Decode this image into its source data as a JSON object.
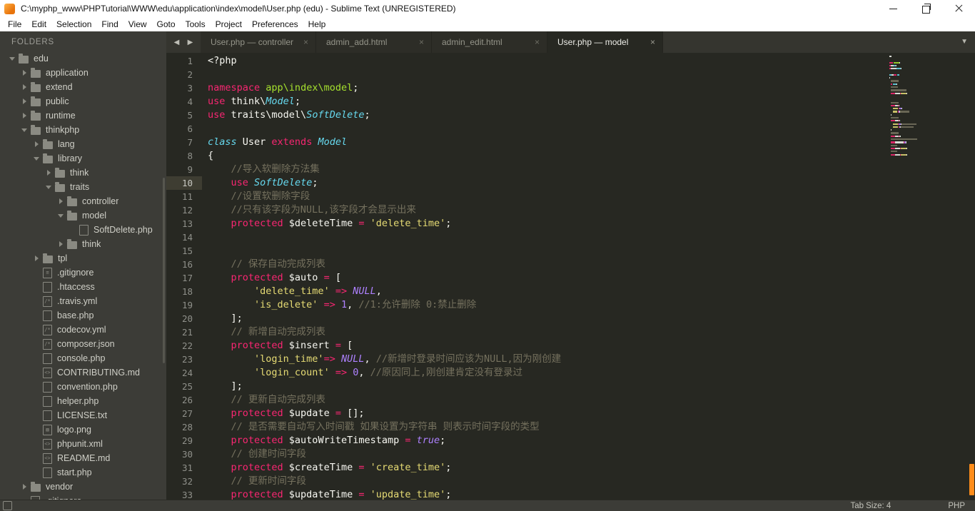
{
  "window": {
    "title": "C:\\myphp_www\\PHPTutorial\\WWW\\edu\\application\\index\\model\\User.php (edu) - Sublime Text (UNREGISTERED)"
  },
  "menu": [
    "File",
    "Edit",
    "Selection",
    "Find",
    "View",
    "Goto",
    "Tools",
    "Project",
    "Preferences",
    "Help"
  ],
  "icons": {
    "nav_back": "◀",
    "nav_forward": "▶",
    "overflow": "▼",
    "tab_close": "×"
  },
  "sidebar": {
    "header": "FOLDERS",
    "items": [
      {
        "label": "edu",
        "icon": "folder",
        "arrow": "open",
        "depth": 0
      },
      {
        "label": "application",
        "icon": "folder",
        "arrow": "closed",
        "depth": 1
      },
      {
        "label": "extend",
        "icon": "folder",
        "arrow": "closed",
        "depth": 1
      },
      {
        "label": "public",
        "icon": "folder",
        "arrow": "closed",
        "depth": 1
      },
      {
        "label": "runtime",
        "icon": "folder",
        "arrow": "closed",
        "depth": 1
      },
      {
        "label": "thinkphp",
        "icon": "folder",
        "arrow": "open",
        "depth": 1
      },
      {
        "label": "lang",
        "icon": "folder",
        "arrow": "closed",
        "depth": 2
      },
      {
        "label": "library",
        "icon": "folder",
        "arrow": "open",
        "depth": 2
      },
      {
        "label": "think",
        "icon": "folder",
        "arrow": "closed",
        "depth": 3
      },
      {
        "label": "traits",
        "icon": "folder",
        "arrow": "open",
        "depth": 3
      },
      {
        "label": "controller",
        "icon": "folder",
        "arrow": "closed",
        "depth": 4
      },
      {
        "label": "model",
        "icon": "folder",
        "arrow": "open",
        "depth": 4
      },
      {
        "label": "SoftDelete.php",
        "icon": "file",
        "arrow": "none",
        "depth": 5
      },
      {
        "label": "think",
        "icon": "folder",
        "arrow": "closed",
        "depth": 4
      },
      {
        "label": "tpl",
        "icon": "folder",
        "arrow": "closed",
        "depth": 2
      },
      {
        "label": ".gitignore",
        "icon": "file-list",
        "arrow": "none",
        "depth": 2
      },
      {
        "label": ".htaccess",
        "icon": "file",
        "arrow": "none",
        "depth": 2
      },
      {
        "label": ".travis.yml",
        "icon": "file-config",
        "arrow": "none",
        "depth": 2
      },
      {
        "label": "base.php",
        "icon": "file",
        "arrow": "none",
        "depth": 2
      },
      {
        "label": "codecov.yml",
        "icon": "file-config",
        "arrow": "none",
        "depth": 2
      },
      {
        "label": "composer.json",
        "icon": "file-config",
        "arrow": "none",
        "depth": 2
      },
      {
        "label": "console.php",
        "icon": "file",
        "arrow": "none",
        "depth": 2
      },
      {
        "label": "CONTRIBUTING.md",
        "icon": "file-code",
        "arrow": "none",
        "depth": 2
      },
      {
        "label": "convention.php",
        "icon": "file",
        "arrow": "none",
        "depth": 2
      },
      {
        "label": "helper.php",
        "icon": "file",
        "arrow": "none",
        "depth": 2
      },
      {
        "label": "LICENSE.txt",
        "icon": "file",
        "arrow": "none",
        "depth": 2
      },
      {
        "label": "logo.png",
        "icon": "file-image",
        "arrow": "none",
        "depth": 2
      },
      {
        "label": "phpunit.xml",
        "icon": "file-code",
        "arrow": "none",
        "depth": 2
      },
      {
        "label": "README.md",
        "icon": "file-code",
        "arrow": "none",
        "depth": 2
      },
      {
        "label": "start.php",
        "icon": "file",
        "arrow": "none",
        "depth": 2
      },
      {
        "label": "vendor",
        "icon": "folder",
        "arrow": "closed",
        "depth": 1
      },
      {
        "label": ".gitignore",
        "icon": "file-list",
        "arrow": "none",
        "depth": 1
      }
    ]
  },
  "tabs": [
    {
      "label": "User.php — controller",
      "active": false
    },
    {
      "label": "admin_add.html",
      "active": false
    },
    {
      "label": "admin_edit.html",
      "active": false
    },
    {
      "label": "User.php — model",
      "active": true
    }
  ],
  "editor": {
    "active_line": 10,
    "lines": [
      {
        "n": 1,
        "t": [
          [
            "pl",
            "<?php"
          ]
        ]
      },
      {
        "n": 2,
        "t": []
      },
      {
        "n": 3,
        "t": [
          [
            "kw",
            "namespace"
          ],
          [
            "pl",
            " "
          ],
          [
            "gr",
            "app\\index\\model"
          ],
          [
            "pl",
            ";"
          ]
        ]
      },
      {
        "n": 4,
        "t": [
          [
            "kw",
            "use"
          ],
          [
            "pl",
            " think\\"
          ],
          [
            "ty",
            "Model"
          ],
          [
            "pl",
            ";"
          ]
        ]
      },
      {
        "n": 5,
        "t": [
          [
            "kw",
            "use"
          ],
          [
            "pl",
            " traits\\model\\"
          ],
          [
            "ty",
            "SoftDelete"
          ],
          [
            "pl",
            ";"
          ]
        ]
      },
      {
        "n": 6,
        "t": []
      },
      {
        "n": 7,
        "t": [
          [
            "ty",
            "class"
          ],
          [
            "pl",
            " User "
          ],
          [
            "kw",
            "extends"
          ],
          [
            "pl",
            " "
          ],
          [
            "ty",
            "Model"
          ]
        ]
      },
      {
        "n": 8,
        "t": [
          [
            "pl",
            "{"
          ]
        ]
      },
      {
        "n": 9,
        "t": [
          [
            "cm",
            "    //导入软删除方法集"
          ]
        ]
      },
      {
        "n": 10,
        "t": [
          [
            "pl",
            "    "
          ],
          [
            "kw",
            "use"
          ],
          [
            "pl",
            " "
          ],
          [
            "ty",
            "SoftDelete"
          ],
          [
            "pl",
            ";"
          ]
        ]
      },
      {
        "n": 11,
        "t": [
          [
            "cm",
            "    //设置软删除字段"
          ]
        ]
      },
      {
        "n": 12,
        "t": [
          [
            "cm",
            "    //只有该字段为NULL,该字段才会显示出来"
          ]
        ]
      },
      {
        "n": 13,
        "t": [
          [
            "pl",
            "    "
          ],
          [
            "kw",
            "protected"
          ],
          [
            "pl",
            " $deleteTime "
          ],
          [
            "kw",
            "="
          ],
          [
            "pl",
            " "
          ],
          [
            "str",
            "'delete_time'"
          ],
          [
            "pl",
            ";"
          ]
        ]
      },
      {
        "n": 14,
        "t": []
      },
      {
        "n": 15,
        "t": []
      },
      {
        "n": 16,
        "t": [
          [
            "cm",
            "    // 保存自动完成列表"
          ]
        ]
      },
      {
        "n": 17,
        "t": [
          [
            "pl",
            "    "
          ],
          [
            "kw",
            "protected"
          ],
          [
            "pl",
            " $auto "
          ],
          [
            "kw",
            "="
          ],
          [
            "pl",
            " ["
          ]
        ]
      },
      {
        "n": 18,
        "t": [
          [
            "pl",
            "        "
          ],
          [
            "str",
            "'delete_time'"
          ],
          [
            "pl",
            " "
          ],
          [
            "kw",
            "=>"
          ],
          [
            "pl",
            " "
          ],
          [
            "cni",
            "NULL"
          ],
          [
            "pl",
            ","
          ]
        ]
      },
      {
        "n": 19,
        "t": [
          [
            "pl",
            "        "
          ],
          [
            "str",
            "'is_delete'"
          ],
          [
            "pl",
            " "
          ],
          [
            "kw",
            "=>"
          ],
          [
            "pl",
            " "
          ],
          [
            "cn",
            "1"
          ],
          [
            "pl",
            ", "
          ],
          [
            "cm",
            "//1:允许删除 0:禁止删除"
          ]
        ]
      },
      {
        "n": 20,
        "t": [
          [
            "pl",
            "    ];"
          ]
        ]
      },
      {
        "n": 21,
        "t": [
          [
            "cm",
            "    // 新增自动完成列表"
          ]
        ]
      },
      {
        "n": 22,
        "t": [
          [
            "pl",
            "    "
          ],
          [
            "kw",
            "protected"
          ],
          [
            "pl",
            " $insert "
          ],
          [
            "kw",
            "="
          ],
          [
            "pl",
            " ["
          ]
        ]
      },
      {
        "n": 23,
        "t": [
          [
            "pl",
            "        "
          ],
          [
            "str",
            "'login_time'"
          ],
          [
            "kw",
            "=>"
          ],
          [
            "pl",
            " "
          ],
          [
            "cni",
            "NULL"
          ],
          [
            "pl",
            ", "
          ],
          [
            "cm",
            "//新增时登录时间应该为NULL,因为刚创建"
          ]
        ]
      },
      {
        "n": 24,
        "t": [
          [
            "pl",
            "        "
          ],
          [
            "str",
            "'login_count'"
          ],
          [
            "pl",
            " "
          ],
          [
            "kw",
            "=>"
          ],
          [
            "pl",
            " "
          ],
          [
            "cn",
            "0"
          ],
          [
            "pl",
            ", "
          ],
          [
            "cm",
            "//原因同上,刚创建肯定没有登录过"
          ]
        ]
      },
      {
        "n": 25,
        "t": [
          [
            "pl",
            "    ];"
          ]
        ]
      },
      {
        "n": 26,
        "t": [
          [
            "cm",
            "    // 更新自动完成列表"
          ]
        ]
      },
      {
        "n": 27,
        "t": [
          [
            "pl",
            "    "
          ],
          [
            "kw",
            "protected"
          ],
          [
            "pl",
            " $update "
          ],
          [
            "kw",
            "="
          ],
          [
            "pl",
            " [];"
          ]
        ]
      },
      {
        "n": 28,
        "t": [
          [
            "cm",
            "    // 是否需要自动写入时间戳 如果设置为字符串 则表示时间字段的类型"
          ]
        ]
      },
      {
        "n": 29,
        "t": [
          [
            "pl",
            "    "
          ],
          [
            "kw",
            "protected"
          ],
          [
            "pl",
            " $autoWriteTimestamp "
          ],
          [
            "kw",
            "="
          ],
          [
            "pl",
            " "
          ],
          [
            "cni",
            "true"
          ],
          [
            "pl",
            ";"
          ]
        ]
      },
      {
        "n": 30,
        "t": [
          [
            "cm",
            "    // 创建时间字段"
          ]
        ]
      },
      {
        "n": 31,
        "t": [
          [
            "pl",
            "    "
          ],
          [
            "kw",
            "protected"
          ],
          [
            "pl",
            " $createTime "
          ],
          [
            "kw",
            "="
          ],
          [
            "pl",
            " "
          ],
          [
            "str",
            "'create_time'"
          ],
          [
            "pl",
            ";"
          ]
        ]
      },
      {
        "n": 32,
        "t": [
          [
            "cm",
            "    // 更新时间字段"
          ]
        ]
      },
      {
        "n": 33,
        "t": [
          [
            "pl",
            "    "
          ],
          [
            "kw",
            "protected"
          ],
          [
            "pl",
            " $updateTime "
          ],
          [
            "kw",
            "="
          ],
          [
            "pl",
            " "
          ],
          [
            "str",
            "'update_time'"
          ],
          [
            "pl",
            ";"
          ]
        ]
      }
    ]
  },
  "status_bar": {
    "tab_size_label": "Tab Size: 4",
    "syntax_label": "PHP"
  }
}
